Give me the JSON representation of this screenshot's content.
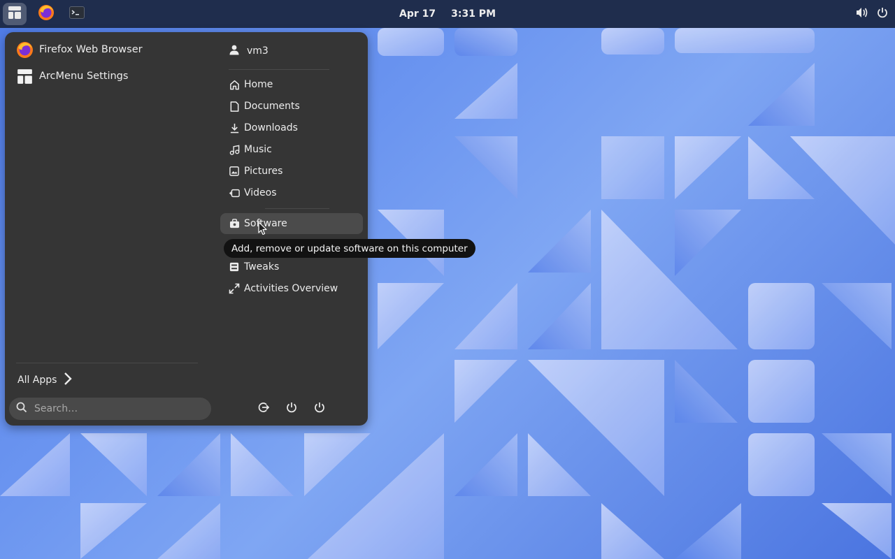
{
  "topbar": {
    "date": "Apr 17",
    "time": "3:31 PM",
    "icons": [
      "arcmenu-icon",
      "firefox-icon",
      "terminal-icon",
      "volume-icon",
      "power-icon"
    ]
  },
  "menu": {
    "pinned_apps": [
      {
        "label": "Firefox Web Browser",
        "icon": "firefox-icon"
      },
      {
        "label": "ArcMenu Settings",
        "icon": "arcmenu-settings-icon"
      }
    ],
    "user": {
      "name": "vm3"
    },
    "places": [
      {
        "label": "Home",
        "icon": "home-icon"
      },
      {
        "label": "Documents",
        "icon": "document-icon"
      },
      {
        "label": "Downloads",
        "icon": "download-icon"
      },
      {
        "label": "Music",
        "icon": "music-icon"
      },
      {
        "label": "Pictures",
        "icon": "picture-icon"
      },
      {
        "label": "Videos",
        "icon": "video-icon"
      }
    ],
    "tools": [
      {
        "label": "Software",
        "icon": "software-icon"
      },
      {
        "label": "Tweaks",
        "icon": "tweaks-icon"
      },
      {
        "label": "Activities Overview",
        "icon": "expand-icon"
      }
    ],
    "all_apps_label": "All Apps",
    "search_placeholder": "Search…",
    "tooltip": "Add, remove or update software on this computer"
  },
  "colors": {
    "topbar": "#1f2d4d",
    "menu_bg": "#353535",
    "hover": "#4b4b4b",
    "tooltip_bg": "#121212"
  }
}
